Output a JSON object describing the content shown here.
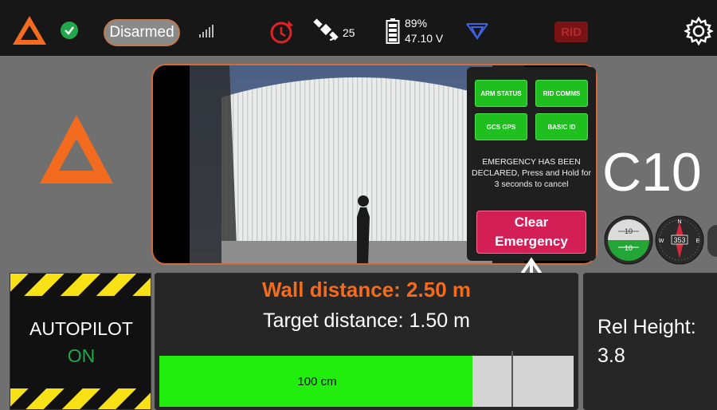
{
  "topbar": {
    "arm_button": "Disarmed",
    "satellites": "25",
    "battery_percent": "89%",
    "battery_voltage": "47.10 V",
    "remote_id": "RID"
  },
  "main": {
    "vehicle_id": "C10"
  },
  "emergency_panel": {
    "buttons": [
      "ARM STATUS",
      "RID COMMS",
      "GCS GPS",
      "BASIC ID"
    ],
    "message": "EMERGENCY HAS BEEN DECLARED, Press and Hold for 3 seconds to cancel",
    "clear_line1": "Clear",
    "clear_line2": "Emergency"
  },
  "instruments": {
    "attitude_top": "10",
    "attitude_bottom": "10",
    "heading": "353",
    "compass_n": "N",
    "compass_e": "E",
    "compass_w": "W"
  },
  "autopilot": {
    "title": "AUTOPILOT",
    "state": "ON"
  },
  "wall": {
    "wall_distance": "Wall distance: 2.50 m",
    "target_distance": "Target distance: 1.50 m",
    "bar_label": "100 cm",
    "bar_fill_fraction": 0.755
  },
  "relative": {
    "label": "Rel Height:",
    "value": "3.8"
  },
  "colors": {
    "accent_orange": "#f26b1e",
    "ok_green": "#22a84a",
    "emergency_red": "#d41e56",
    "bar_green": "#22ee0e"
  }
}
